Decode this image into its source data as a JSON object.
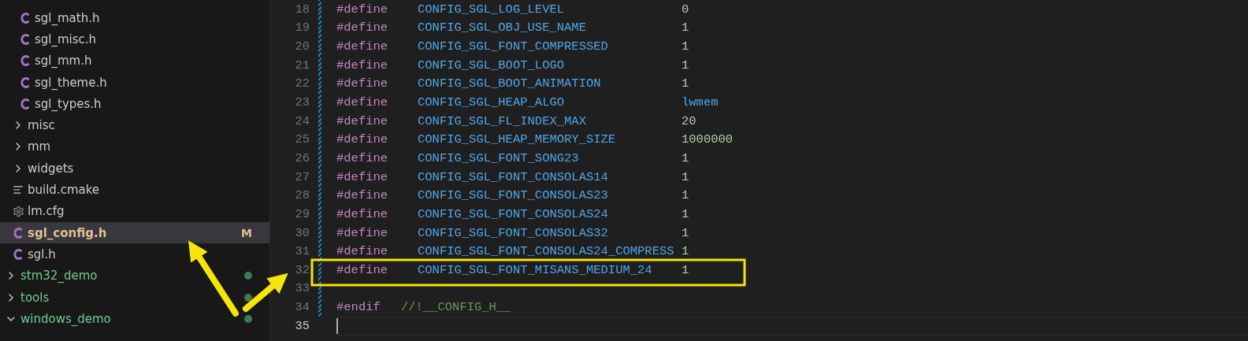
{
  "explorer": {
    "items": [
      {
        "kind": "folder",
        "children": [
          {
            "kind": "folder",
            "children": [
              {
                "kind": "c",
                "label": "sgl_math.h",
                "selected": false
              },
              {
                "kind": "c",
                "label": "sgl_misc.h",
                "selected": false
              },
              {
                "kind": "c",
                "label": "sgl_mm.h",
                "selected": false
              },
              {
                "kind": "c",
                "label": "sgl_theme.h",
                "selected": false
              },
              {
                "kind": "c",
                "label": "sgl_types.h",
                "selected": false
              }
            ]
          },
          {
            "kind": "folder",
            "label": "misc",
            "expanded": false,
            "selected": false
          },
          {
            "kind": "folder",
            "label": "mm",
            "expanded": false,
            "selected": false
          },
          {
            "kind": "folder",
            "label": "widgets",
            "expanded": false,
            "selected": false
          },
          {
            "kind": "text",
            "label": "build.cmake",
            "selected": false
          },
          {
            "kind": "config",
            "label": "lm.cfg",
            "selected": false
          },
          {
            "kind": "c",
            "label": "sgl_config.h",
            "selected": true,
            "badge": "M"
          },
          {
            "kind": "c",
            "label": "sgl.h",
            "selected": false
          }
        ]
      },
      {
        "kind": "folder",
        "label": "stm32_demo",
        "expanded": false,
        "selected": false,
        "changed": true
      },
      {
        "kind": "folder",
        "label": "tools",
        "expanded": false,
        "selected": false,
        "changed": true
      },
      {
        "kind": "folder",
        "label": "windows_demo",
        "expanded": true,
        "selected": false,
        "changed": true
      }
    ]
  },
  "editor": {
    "lines": [
      {
        "number": "18",
        "kind": "define",
        "directive": "#define",
        "name": "CONFIG_SGL_LOG_LEVEL",
        "value": "0",
        "current": false
      },
      {
        "number": "19",
        "kind": "define",
        "directive": "#define",
        "name": "CONFIG_SGL_OBJ_USE_NAME",
        "value": "1",
        "current": false
      },
      {
        "number": "20",
        "kind": "define",
        "directive": "#define",
        "name": "CONFIG_SGL_FONT_COMPRESSED",
        "value": "1",
        "current": false
      },
      {
        "number": "21",
        "kind": "define",
        "directive": "#define",
        "name": "CONFIG_SGL_BOOT_LOGO",
        "value": "1",
        "current": false
      },
      {
        "number": "22",
        "kind": "define",
        "directive": "#define",
        "name": "CONFIG_SGL_BOOT_ANIMATION",
        "value": "1",
        "current": false
      },
      {
        "number": "23",
        "kind": "define",
        "directive": "#define",
        "name": "CONFIG_SGL_HEAP_ALGO",
        "value": "lwmem",
        "current": false
      },
      {
        "number": "24",
        "kind": "define",
        "directive": "#define",
        "name": "CONFIG_SGL_FL_INDEX_MAX",
        "value": "20",
        "current": false
      },
      {
        "number": "25",
        "kind": "define",
        "directive": "#define",
        "name": "CONFIG_SGL_HEAP_MEMORY_SIZE",
        "value": "1000000",
        "current": false
      },
      {
        "number": "26",
        "kind": "define",
        "directive": "#define",
        "name": "CONFIG_SGL_FONT_SONG23",
        "value": "1",
        "current": false
      },
      {
        "number": "27",
        "kind": "define",
        "directive": "#define",
        "name": "CONFIG_SGL_FONT_CONSOLAS14",
        "value": "1",
        "current": false
      },
      {
        "number": "28",
        "kind": "define",
        "directive": "#define",
        "name": "CONFIG_SGL_FONT_CONSOLAS23",
        "value": "1",
        "current": false
      },
      {
        "number": "29",
        "kind": "define",
        "directive": "#define",
        "name": "CONFIG_SGL_FONT_CONSOLAS24",
        "value": "1",
        "current": false
      },
      {
        "number": "30",
        "kind": "define",
        "directive": "#define",
        "name": "CONFIG_SGL_FONT_CONSOLAS32",
        "value": "1",
        "current": false
      },
      {
        "number": "31",
        "kind": "define",
        "directive": "#define",
        "name": "CONFIG_SGL_FONT_CONSOLAS24_COMPRESS",
        "value": "1",
        "current": false
      },
      {
        "number": "32",
        "kind": "define",
        "directive": "#define",
        "name": "CONFIG_SGL_FONT_MISANS_MEDIUM_24",
        "value": "1",
        "current": false
      },
      {
        "number": "33",
        "kind": "blank",
        "current": false
      },
      {
        "number": "34",
        "kind": "endif",
        "directive": "#endif",
        "comment": "//!__CONFIG_H__",
        "current": false
      },
      {
        "number": "35",
        "kind": "blank",
        "current": true
      }
    ]
  }
}
